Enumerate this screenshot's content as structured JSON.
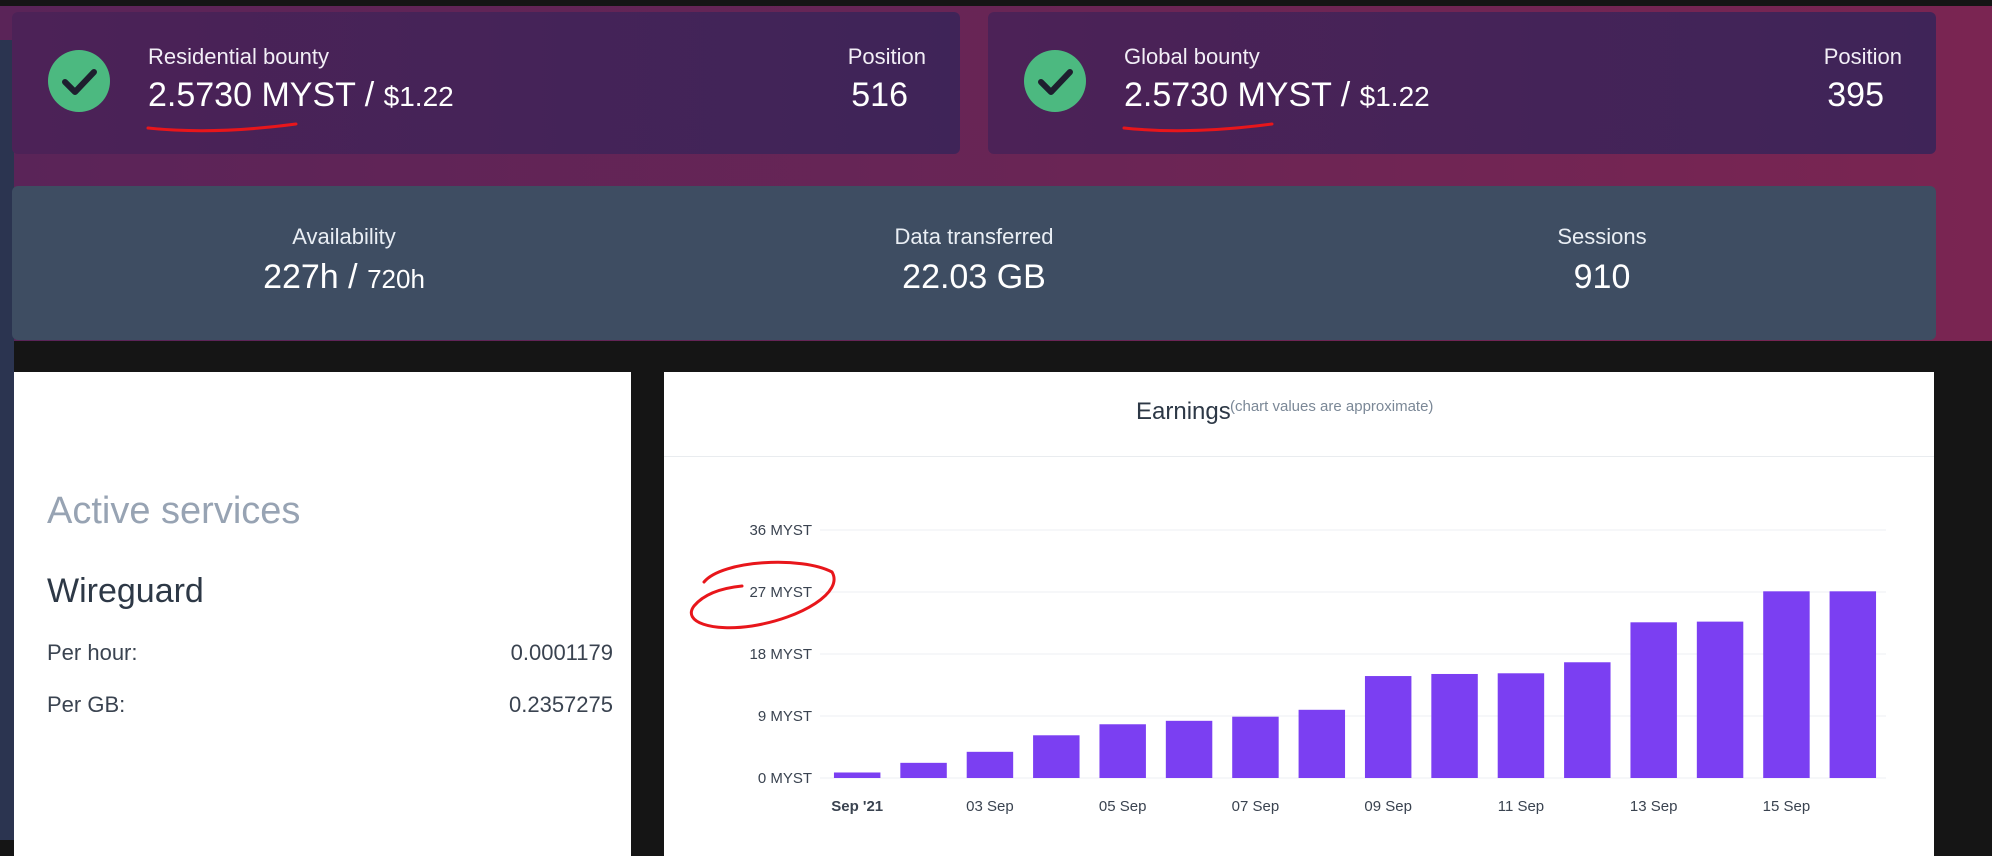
{
  "bounties": [
    {
      "label": "Residential bounty",
      "myst": "2.5730 MYST",
      "sep": "/",
      "usd": "$1.22",
      "position_label": "Position",
      "position": "516"
    },
    {
      "label": "Global bounty",
      "myst": "2.5730 MYST",
      "sep": "/",
      "usd": "$1.22",
      "position_label": "Position",
      "position": "395"
    }
  ],
  "stats": {
    "availability": {
      "label": "Availability",
      "value": "227h",
      "sep": "/",
      "total": "720h"
    },
    "data": {
      "label": "Data transferred",
      "value": "22.03 GB"
    },
    "sessions": {
      "label": "Sessions",
      "value": "910"
    }
  },
  "services": {
    "title": "Active services",
    "name": "Wireguard",
    "per_hour_label": "Per hour:",
    "per_hour": "0.0001179",
    "per_gb_label": "Per GB:",
    "per_gb": "0.2357275"
  },
  "earnings": {
    "title": "Earnings",
    "note": "(chart values are approximate)"
  },
  "colors": {
    "bar": "#7b3ff2",
    "check": "#4cb980",
    "annotation": "#e8161b"
  },
  "icons": {
    "bounty_status": "check-circle-icon"
  },
  "chart_data": {
    "type": "bar",
    "categories": [
      "Sep '21",
      "02 Sep",
      "03 Sep",
      "04 Sep",
      "05 Sep",
      "06 Sep",
      "07 Sep",
      "08 Sep",
      "09 Sep",
      "10 Sep",
      "11 Sep",
      "12 Sep",
      "13 Sep",
      "14 Sep",
      "15 Sep",
      "16 Sep"
    ],
    "tick_labels": [
      "Sep '21",
      "03 Sep",
      "05 Sep",
      "07 Sep",
      "09 Sep",
      "11 Sep",
      "13 Sep",
      "15 Sep"
    ],
    "y_ticks": [
      "0 MYST",
      "9 MYST",
      "18 MYST",
      "27 MYST",
      "36 MYST"
    ],
    "values": [
      0.8,
      2.2,
      3.8,
      6.2,
      7.8,
      8.3,
      8.9,
      9.9,
      14.8,
      15.1,
      15.2,
      16.8,
      22.6,
      22.7,
      27.1,
      27.1
    ],
    "ylim": [
      0,
      36
    ],
    "grid": true
  }
}
